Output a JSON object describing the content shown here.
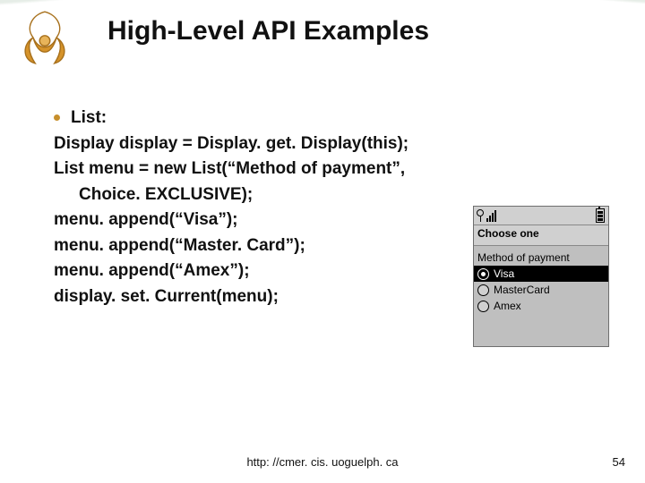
{
  "title": "High-Level API Examples",
  "bullet_label": "List:",
  "code": {
    "l1": "Display display = Display. get. Display(this);",
    "l2": "List menu = new List(“Method of payment”,",
    "l2b": "Choice. EXCLUSIVE);",
    "l3": "menu. append(“Visa”);",
    "l4": "menu. append(“Master. Card”);",
    "l5": "menu. append(“Amex”);",
    "l6": "display. set. Current(menu);"
  },
  "phone": {
    "window_title": "Choose one",
    "prompt": "Method of payment",
    "options": [
      {
        "label": "Visa",
        "selected": true
      },
      {
        "label": "MasterCard",
        "selected": false
      },
      {
        "label": "Amex",
        "selected": false
      }
    ]
  },
  "footer_url": "http: //cmer. cis. uoguelph. ca",
  "page_number": "54",
  "colors": {
    "accent": "#c78f2c"
  }
}
